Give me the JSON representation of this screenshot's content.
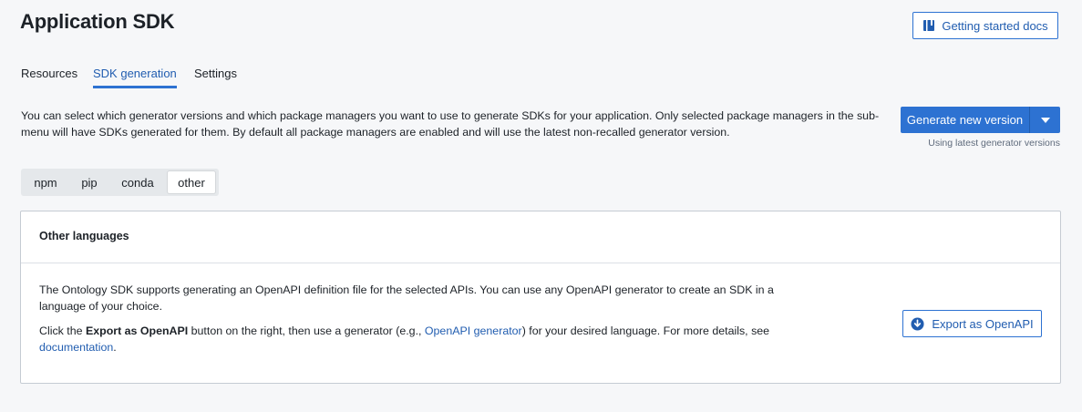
{
  "header": {
    "title": "Application SDK",
    "docs_button": {
      "label": "Getting started docs",
      "icon": "book-icon"
    }
  },
  "tabs": [
    {
      "label": "Resources",
      "active": false
    },
    {
      "label": "SDK generation",
      "active": true
    },
    {
      "label": "Settings",
      "active": false
    }
  ],
  "intro": {
    "text": "You can select which generator versions and which package managers you want to use to generate SDKs for your application. Only selected package managers in the sub-menu will have SDKs generated for them. By default all package managers are enabled and will use the latest non-recalled generator version."
  },
  "generate": {
    "label": "Generate new version",
    "caret_icon": "caret-down-icon",
    "note": "Using latest generator versions"
  },
  "package_tabs": [
    {
      "label": "npm",
      "active": false
    },
    {
      "label": "pip",
      "active": false
    },
    {
      "label": "conda",
      "active": false
    },
    {
      "label": "other",
      "active": true
    }
  ],
  "card": {
    "title": "Other languages",
    "paragraph1": "The Ontology SDK supports generating an OpenAPI definition file for the selected APIs. You can use any OpenAPI generator to create an SDK in a language of your choice.",
    "p2_prefix": "Click the ",
    "p2_bold": "Export as OpenAPI",
    "p2_middle": " button on the right, then use a generator (e.g., ",
    "p2_link": "OpenAPI generator",
    "p2_middle2": ") for your desired language. For more details, see ",
    "p2_link2": "documentation",
    "p2_end": ".",
    "export_button": {
      "label": "Export as OpenAPI",
      "icon": "download-icon"
    }
  },
  "colors": {
    "accent": "#2d72d2",
    "link": "#215db0",
    "background": "#f6f7f9"
  }
}
